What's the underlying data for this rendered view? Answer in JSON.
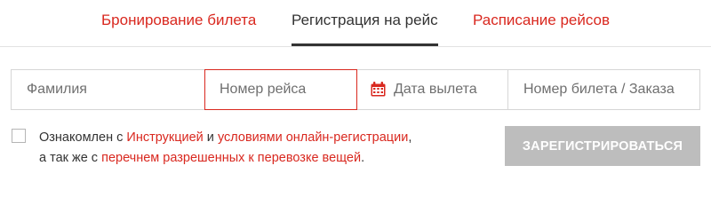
{
  "tabs": [
    {
      "label": "Бронирование билета",
      "active": false
    },
    {
      "label": "Регистрация на рейс",
      "active": true
    },
    {
      "label": "Расписание рейсов",
      "active": false
    }
  ],
  "form": {
    "surname_placeholder": "Фамилия",
    "flight_placeholder": "Номер рейса",
    "date_placeholder": "Дата вылета",
    "date_icon": "calendar-icon",
    "ticket_placeholder": "Номер билета / Заказа"
  },
  "agreement": {
    "text1": "Ознакомлен с ",
    "link1": "Инструкцией",
    "text2": " и ",
    "link2": "условиями онлайн-регистрации",
    "text3": ",",
    "text4": "а так же с ",
    "link3": "перечнем разрешенных к перевозке вещей",
    "text5": ".",
    "checked": false
  },
  "submit_label": "ЗАРЕГИСТРИРОВАТЬСЯ",
  "colors": {
    "accent": "#d9281f",
    "text": "#333333",
    "button_disabled": "#bdbdbd"
  }
}
